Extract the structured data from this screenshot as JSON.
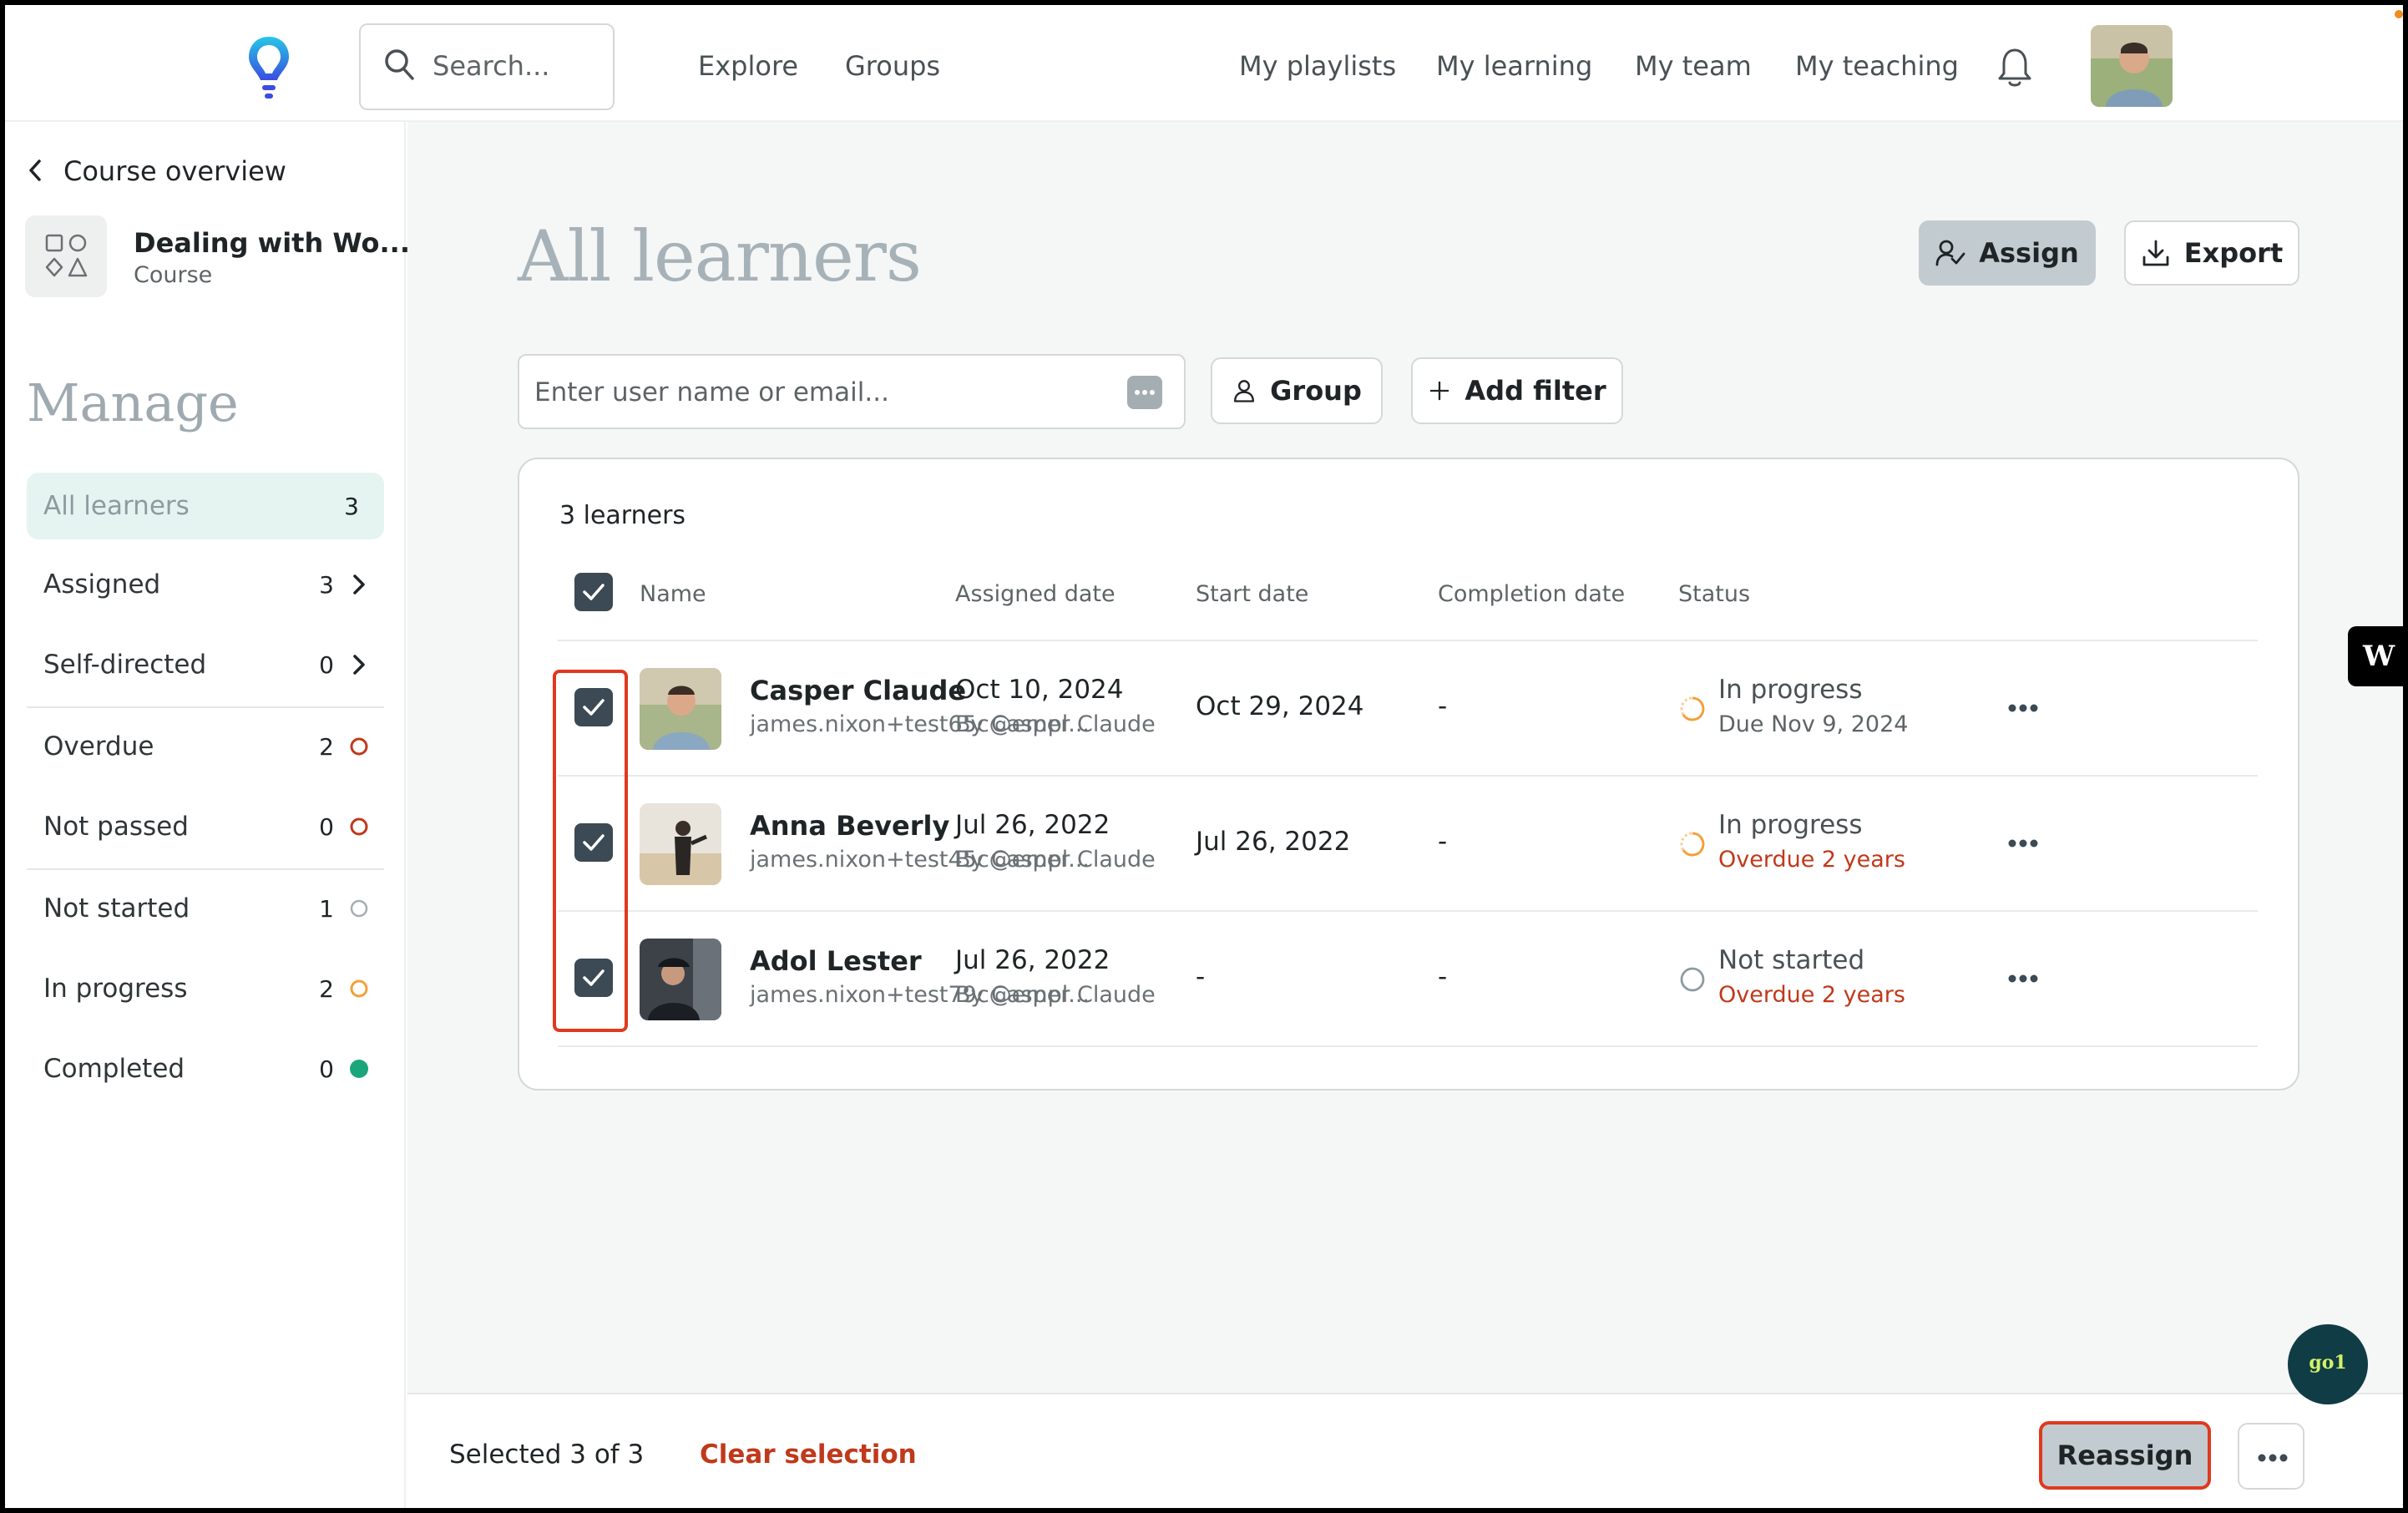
{
  "topnav": {
    "search_placeholder": "Search...",
    "links": [
      "Explore",
      "Groups",
      "My playlists",
      "My learning",
      "My team",
      "My teaching"
    ]
  },
  "sidebar": {
    "back_label": "Course overview",
    "course": {
      "title": "Dealing with Wo...",
      "type": "Course"
    },
    "heading": "Manage",
    "items": [
      {
        "label": "All learners",
        "count": "3",
        "indicator": "none"
      },
      {
        "label": "Assigned",
        "count": "3",
        "indicator": "chevron-right-icon"
      },
      {
        "label": "Self-directed",
        "count": "0",
        "indicator": "chevron-right-icon"
      },
      {
        "label": "Overdue",
        "count": "2",
        "indicator": "red-ring-icon"
      },
      {
        "label": "Not passed",
        "count": "0",
        "indicator": "red-ring-icon"
      },
      {
        "label": "Not started",
        "count": "1",
        "indicator": "grey-ring-icon"
      },
      {
        "label": "In progress",
        "count": "2",
        "indicator": "orange-ring-icon"
      },
      {
        "label": "Completed",
        "count": "0",
        "indicator": "green-dot-icon"
      }
    ]
  },
  "main": {
    "title": "All learners",
    "assign_label": "Assign",
    "export_label": "Export",
    "filter_placeholder": "Enter user name or email...",
    "group_label": "Group",
    "add_filter_label": "Add filter",
    "learner_count": "3 learners",
    "columns": [
      "Name",
      "Assigned date",
      "Start date",
      "Completion date",
      "Status"
    ],
    "rows": [
      {
        "name": "Casper Claude",
        "email": "james.nixon+test65c@empl...",
        "assigned_date": "Oct 10, 2024",
        "assigned_by": "By Casper Claude",
        "start_date": "Oct 29, 2024",
        "completion_date": "-",
        "status": "In progress",
        "status_sub": "Due Nov 9, 2024",
        "status_icon": "in-progress-icon",
        "checked": true
      },
      {
        "name": "Anna Beverly",
        "email": "james.nixon+test45c@empl...",
        "assigned_date": "Jul 26, 2022",
        "assigned_by": "By Casper Claude",
        "start_date": "Jul 26, 2022",
        "completion_date": "-",
        "status": "In progress",
        "status_sub": "Overdue 2 years",
        "status_icon": "in-progress-icon",
        "checked": true
      },
      {
        "name": "Adol Lester",
        "email": "james.nixon+test79c@empl...",
        "assigned_date": "Jul 26, 2022",
        "assigned_by": "By Casper Claude",
        "start_date": "-",
        "completion_date": "-",
        "status": "Not started",
        "status_sub": "Overdue 2 years",
        "status_icon": "not-started-icon",
        "checked": true
      }
    ]
  },
  "bottom_bar": {
    "selected_text": "Selected 3 of 3",
    "clear_label": "Clear selection",
    "reassign_label": "Reassign"
  },
  "floating": {
    "chat_label": "go1",
    "badge_label": "W"
  },
  "colors": {
    "accent_teal": "#103c45",
    "overdue_red": "#c0391b",
    "highlight_red": "#e0391f",
    "progress_orange": "#f2a03a",
    "completed_green": "#1aa67a",
    "active_item_bg": "#e5f4f0"
  }
}
